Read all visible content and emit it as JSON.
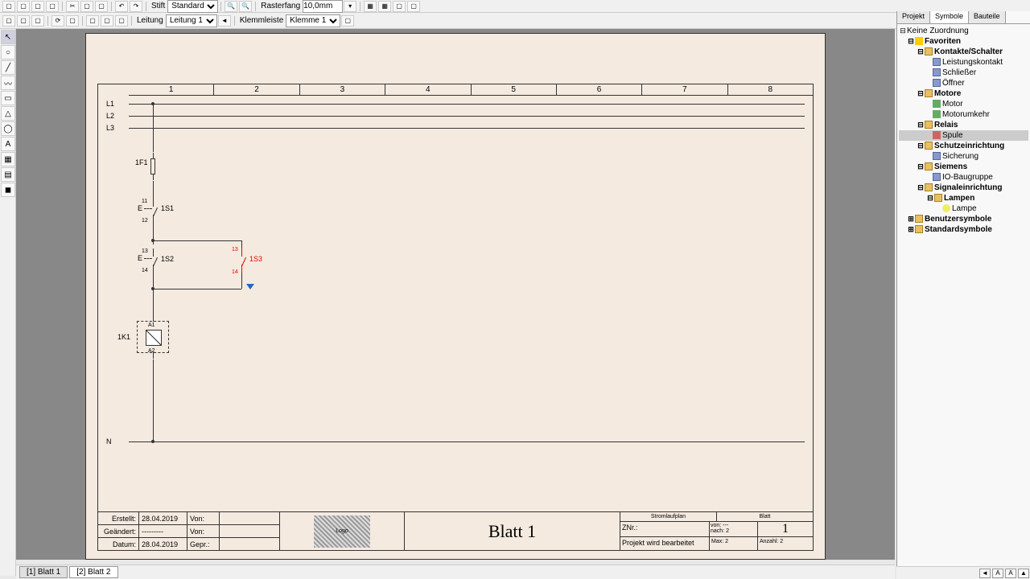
{
  "toolbar1": {
    "stift_label": "Stift",
    "stift_value": "Standard",
    "raster_label": "Rasterfang",
    "raster_value": "10,0mm"
  },
  "toolbar2": {
    "leitung_label": "Leitung",
    "leitung_value": "Leitung 1",
    "klemm_label": "Klemmleiste",
    "klemm_value": "Klemme 1"
  },
  "columns": [
    "1",
    "2",
    "3",
    "4",
    "5",
    "6",
    "7",
    "8"
  ],
  "rails": {
    "l1": "L1",
    "l2": "L2",
    "l3": "L3",
    "n": "N"
  },
  "components": {
    "fuse1": "1F1",
    "s1": "1S1",
    "s2": "1S2",
    "s3": "1S3",
    "k1": "1K1",
    "a1": "A1",
    "a2": "A2",
    "t11": "11",
    "t12": "12",
    "t13": "13",
    "t14": "14"
  },
  "titleblock": {
    "erstellt_lbl": "Erstellt:",
    "erstellt_date": "28.04.2019",
    "von_lbl": "Von:",
    "geaendert_lbl": "Geändert:",
    "geaendert_date": "---------",
    "datum_lbl": "Datum:",
    "datum_date": "28.04.2019",
    "gepr_lbl": "Gepr.:",
    "logo_text": "Logo",
    "sheet_title": "Blatt 1",
    "stromlaufplan": "Stromlaufplan",
    "blatt": "Blatt",
    "znr": "ZNr.:",
    "nach": "nach: 2",
    "max": "Max: 2",
    "projekt": "Projekt wird bearbeitet",
    "anzahl": "Anzahl: 2",
    "von_dash": "von: ---",
    "page_num": "1"
  },
  "right_panel": {
    "tab_projekt": "Projekt",
    "tab_symbole": "Symbole",
    "tab_bauteile": "Bauteile",
    "tree": {
      "root": "Keine Zuordnung",
      "favoriten": "Favoriten",
      "kontakte": "Kontakte/Schalter",
      "leistung": "Leistungskontakt",
      "schliesser": "Schließer",
      "oeffner": "Öffner",
      "motore": "Motore",
      "motor": "Motor",
      "motorumk": "Motorumkehr",
      "relais": "Relais",
      "spule": "Spule",
      "schutz": "Schutzeinrichtung",
      "sicherung": "Sicherung",
      "siemens": "Siemens",
      "baugruppe": "IO-Baugruppe",
      "signal": "Signaleinrichtung",
      "lampen": "Lampen",
      "lampe": "Lampe",
      "benutzer": "Benutzersymbole",
      "standard": "Standardsymbole"
    }
  },
  "bottom_tabs": {
    "b1": "[1] Blatt 1",
    "b2": "[2] Blatt 2"
  }
}
